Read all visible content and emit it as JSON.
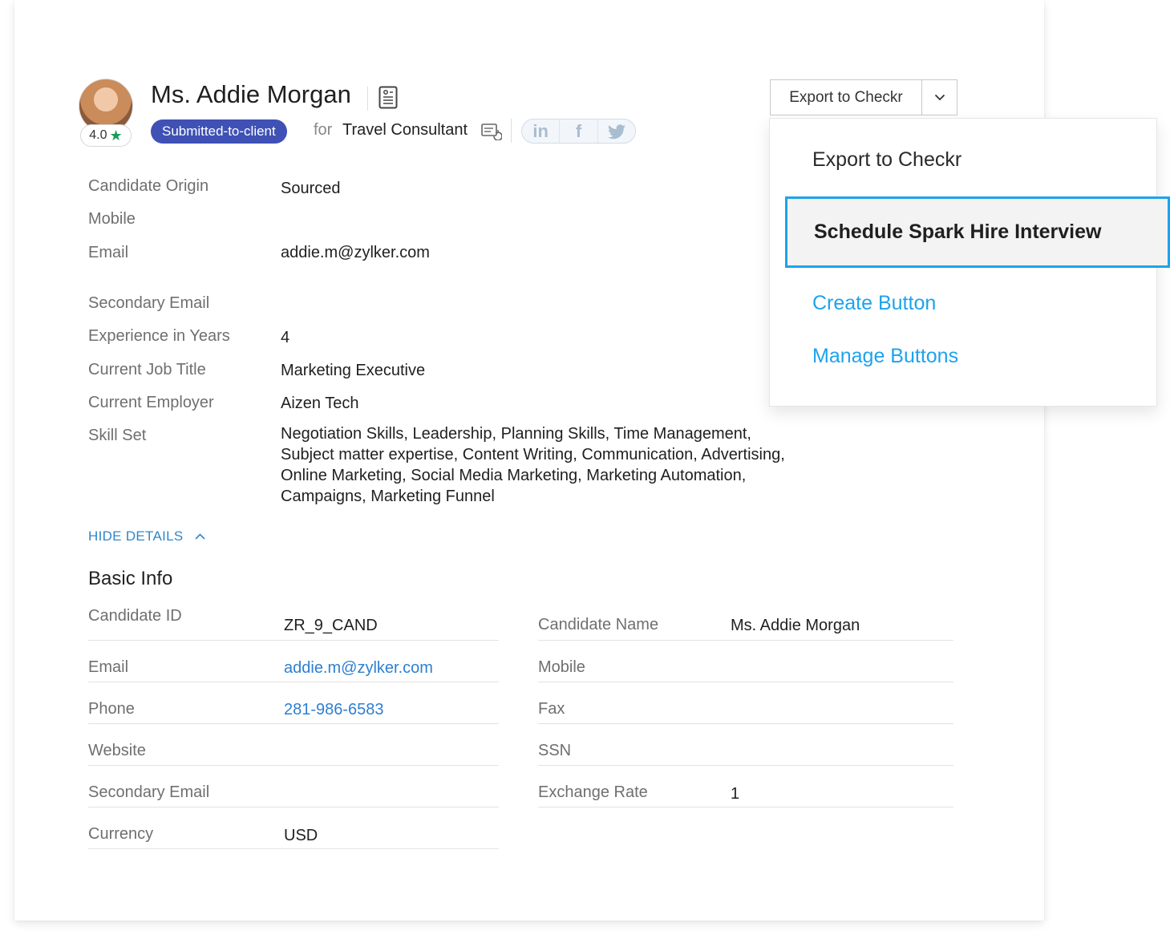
{
  "candidate": {
    "name": "Ms. Addie Morgan",
    "rating": "4.0",
    "status": "Submitted-to-client",
    "for_label": "for",
    "job": "Travel Consultant"
  },
  "social": [
    "in",
    "f",
    "t"
  ],
  "actions": {
    "export_label": "Export to Checkr"
  },
  "dropdown": {
    "items": [
      {
        "label": "Export to Checkr"
      },
      {
        "label": "Schedule Spark Hire Interview"
      },
      {
        "label": "Create Button"
      },
      {
        "label": "Manage Buttons"
      }
    ]
  },
  "details": [
    {
      "label": "Candidate Origin",
      "value": "Sourced"
    },
    {
      "label": "Mobile",
      "value": ""
    },
    {
      "label": "Email",
      "value": "addie.m@zylker.com"
    },
    {
      "label": "Secondary Email",
      "value": ""
    },
    {
      "label": "Experience in Years",
      "value": "4"
    },
    {
      "label": "Current Job Title",
      "value": "Marketing Executive"
    },
    {
      "label": "Current Employer",
      "value": "Aizen Tech"
    },
    {
      "label": "Skill Set",
      "value": "Negotiation Skills, Leadership, Planning Skills, Time Management, Subject matter expertise, Content Writing, Communication, Advertising, Online Marketing, Social Media Marketing, Marketing Automation, Campaigns, Marketing Funnel"
    }
  ],
  "hide_details": "HIDE DETAILS",
  "basic_info": {
    "title": "Basic Info",
    "left": [
      {
        "label": "Candidate ID",
        "value": "ZR_9_CAND"
      },
      {
        "label": "Email",
        "value": "addie.m@zylker.com"
      },
      {
        "label": "Phone",
        "value": "281-986-6583"
      },
      {
        "label": "Website",
        "value": ""
      },
      {
        "label": "Secondary Email",
        "value": ""
      },
      {
        "label": "Currency",
        "value": "USD"
      }
    ],
    "right": [
      {
        "label": "Candidate Name",
        "value": "Ms. Addie Morgan"
      },
      {
        "label": "Mobile",
        "value": ""
      },
      {
        "label": "Fax",
        "value": ""
      },
      {
        "label": "SSN",
        "value": ""
      },
      {
        "label": "Exchange Rate",
        "value": "1"
      }
    ]
  },
  "colors": {
    "status_badge": "#3f51b5",
    "link": "#2f7fd0",
    "dropdown_accent": "#1ca3ec",
    "rating_star": "#1a9c5a"
  }
}
